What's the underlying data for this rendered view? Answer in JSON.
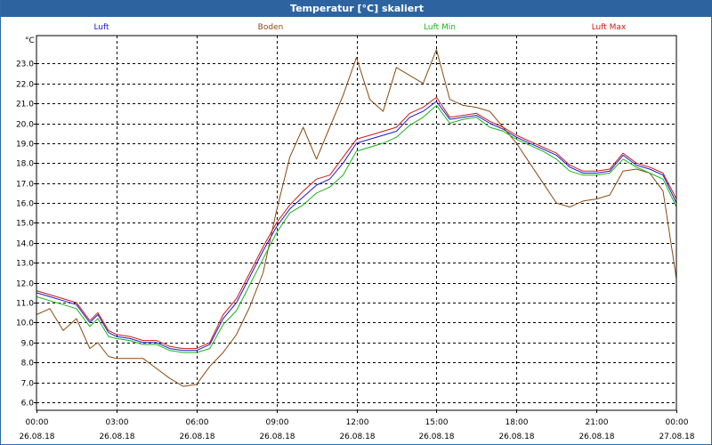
{
  "window": {
    "title": "Temperatur [°C] skaliert"
  },
  "chart_data": {
    "type": "line",
    "title": "Temperatur [°C] skaliert",
    "ylabel": "°C",
    "ylim": [
      5.6,
      24.4
    ],
    "yticks": [
      6.0,
      7.0,
      8.0,
      9.0,
      10.0,
      11.0,
      12.0,
      13.0,
      14.0,
      15.0,
      16.0,
      17.0,
      18.0,
      19.0,
      20.0,
      21.0,
      22.0,
      23.0
    ],
    "ytick_labels": [
      "6.0",
      "7.0",
      "8.0",
      "9.0",
      "10.0",
      "11.0",
      "12.0",
      "13.0",
      "14.0",
      "15.0",
      "16.0",
      "17.0",
      "18.0",
      "19.0",
      "20.0",
      "21.0",
      "22.0",
      "23.0"
    ],
    "xlim": [
      0,
      24
    ],
    "xticks": [
      0,
      3,
      6,
      9,
      12,
      15,
      18,
      21,
      24
    ],
    "xtick_times": [
      "00:00",
      "03:00",
      "06:00",
      "09:00",
      "12:00",
      "15:00",
      "18:00",
      "21:00",
      "00:00"
    ],
    "xtick_dates": [
      "26.08.18",
      "26.08.18",
      "26.08.18",
      "26.08.18",
      "26.08.18",
      "26.08.18",
      "26.08.18",
      "26.08.18",
      "27.08.18"
    ],
    "grid": true,
    "legend_position": "top",
    "series": [
      {
        "name": "Luft",
        "color": "#1a1acc",
        "x": [
          0,
          0.5,
          1,
          1.5,
          2,
          2.3,
          2.7,
          3,
          3.5,
          4,
          4.5,
          5,
          5.5,
          6,
          6.5,
          7,
          7.5,
          8,
          8.5,
          9,
          9.5,
          10,
          10.5,
          11,
          11.5,
          12,
          12.5,
          13,
          13.5,
          14,
          14.5,
          15,
          15.5,
          16,
          16.5,
          17,
          17.5,
          18,
          18.5,
          19,
          19.5,
          20,
          20.5,
          21,
          21.5,
          22,
          22.5,
          23,
          23.5,
          24
        ],
        "y": [
          11.5,
          11.3,
          11.1,
          10.9,
          10.0,
          10.4,
          9.5,
          9.3,
          9.2,
          9.0,
          9.0,
          8.7,
          8.6,
          8.6,
          8.9,
          10.2,
          11.0,
          12.3,
          13.6,
          14.8,
          15.7,
          16.3,
          16.9,
          17.2,
          18.0,
          19.0,
          19.2,
          19.4,
          19.6,
          20.3,
          20.6,
          21.1,
          20.2,
          20.3,
          20.4,
          20.0,
          19.7,
          19.3,
          19.0,
          18.7,
          18.4,
          17.8,
          17.5,
          17.5,
          17.6,
          18.4,
          17.9,
          17.7,
          17.4,
          16.0
        ]
      },
      {
        "name": "Boden",
        "color": "#8b4a12",
        "x": [
          0,
          0.5,
          1,
          1.5,
          2,
          2.3,
          2.7,
          3,
          3.5,
          4,
          4.5,
          5,
          5.5,
          6,
          6.5,
          7,
          7.5,
          8,
          8.5,
          9,
          9.5,
          10,
          10.5,
          11,
          11.5,
          12,
          12.5,
          13,
          13.5,
          14,
          14.5,
          15,
          15.5,
          16,
          16.5,
          17,
          17.5,
          18,
          18.5,
          19,
          19.5,
          20,
          20.5,
          21,
          21.5,
          22,
          22.5,
          23,
          23.5,
          24
        ],
        "y": [
          10.4,
          10.7,
          9.6,
          10.2,
          8.7,
          9.0,
          8.3,
          8.2,
          8.2,
          8.2,
          7.7,
          7.2,
          6.8,
          6.9,
          7.8,
          8.5,
          9.4,
          10.8,
          12.5,
          15.6,
          18.3,
          19.8,
          18.2,
          19.8,
          21.4,
          23.3,
          21.2,
          20.6,
          22.8,
          22.4,
          22.0,
          23.7,
          21.2,
          20.9,
          20.8,
          20.6,
          19.8,
          19.0,
          18.0,
          17.0,
          16.0,
          15.8,
          16.1,
          16.2,
          16.4,
          17.6,
          17.7,
          17.5,
          16.6,
          12.2
        ]
      },
      {
        "name": "Luft Min",
        "color": "#18b418",
        "x": [
          0,
          0.5,
          1,
          1.5,
          2,
          2.3,
          2.7,
          3,
          3.5,
          4,
          4.5,
          5,
          5.5,
          6,
          6.5,
          7,
          7.5,
          8,
          8.5,
          9,
          9.5,
          10,
          10.5,
          11,
          11.5,
          12,
          12.5,
          13,
          13.5,
          14,
          14.5,
          15,
          15.5,
          16,
          16.5,
          17,
          17.5,
          18,
          18.5,
          19,
          19.5,
          20,
          20.5,
          21,
          21.5,
          22,
          22.5,
          23,
          23.5,
          24
        ],
        "y": [
          11.3,
          11.1,
          10.9,
          10.7,
          9.8,
          10.2,
          9.3,
          9.2,
          9.1,
          8.9,
          8.9,
          8.6,
          8.5,
          8.5,
          8.7,
          9.9,
          10.6,
          11.9,
          13.2,
          14.5,
          15.5,
          15.9,
          16.5,
          16.8,
          17.4,
          18.6,
          18.8,
          19.0,
          19.3,
          19.9,
          20.3,
          20.9,
          20.0,
          20.2,
          20.3,
          19.8,
          19.6,
          19.2,
          18.9,
          18.6,
          18.2,
          17.6,
          17.4,
          17.4,
          17.5,
          18.2,
          17.8,
          17.5,
          17.2,
          15.8
        ]
      },
      {
        "name": "Luft Max",
        "color": "#d11717",
        "x": [
          0,
          0.5,
          1,
          1.5,
          2,
          2.3,
          2.7,
          3,
          3.5,
          4,
          4.5,
          5,
          5.5,
          6,
          6.5,
          7,
          7.5,
          8,
          8.5,
          9,
          9.5,
          10,
          10.5,
          11,
          11.5,
          12,
          12.5,
          13,
          13.5,
          14,
          14.5,
          15,
          15.5,
          16,
          16.5,
          17,
          17.5,
          18,
          18.5,
          19,
          19.5,
          20,
          20.5,
          21,
          21.5,
          22,
          22.5,
          23,
          23.5,
          24
        ],
        "y": [
          11.6,
          11.4,
          11.2,
          11.0,
          10.1,
          10.5,
          9.6,
          9.4,
          9.3,
          9.1,
          9.1,
          8.8,
          8.7,
          8.7,
          9.0,
          10.4,
          11.2,
          12.5,
          13.8,
          15.0,
          15.9,
          16.6,
          17.2,
          17.4,
          18.3,
          19.2,
          19.4,
          19.6,
          19.8,
          20.5,
          20.8,
          21.3,
          20.3,
          20.4,
          20.5,
          20.1,
          19.8,
          19.4,
          19.1,
          18.8,
          18.5,
          17.9,
          17.6,
          17.6,
          17.7,
          18.5,
          18.0,
          17.8,
          17.5,
          16.2
        ]
      }
    ]
  }
}
